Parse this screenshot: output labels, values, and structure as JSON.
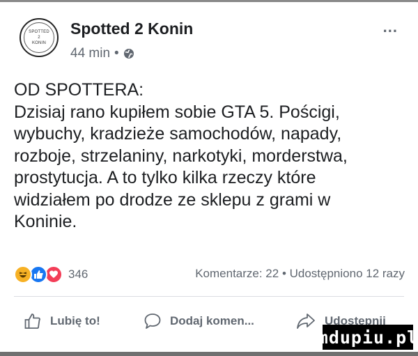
{
  "header": {
    "page_name": "Spotted 2 Konin",
    "time": "44 min",
    "separator": "•",
    "avatar_lines": [
      "SPOTTED",
      "2",
      "KONIN"
    ],
    "more": "..."
  },
  "post": {
    "lines": [
      "OD SPOTTERA:",
      "Dzisiaj rano kupiłem sobie GTA 5. Pościgi,",
      "wybuchy, kradzieże samochodów, napady,",
      "rozboje, strzelaniny, narkotyki, morderstwa,",
      "prostytucja. A to tylko kilka rzeczy które",
      "widziałem po drodze ze sklepu z grami w",
      "Koninie."
    ]
  },
  "reactions": {
    "icons": [
      "haha-reaction-icon",
      "like-reaction-icon",
      "love-reaction-icon"
    ],
    "count": "346",
    "stats": "Komentarze: 22 • Udostępniono 12 razy"
  },
  "actions": {
    "like": "Lubię to!",
    "comment": "Dodaj komen...",
    "share": "Udostępnij"
  },
  "watermark": "mdupiu.pl",
  "colors": {
    "text": "#1c1e21",
    "muted": "#606770",
    "like_blue": "#1877f2",
    "love_red": "#f33e58",
    "haha_yellow": "#f7b125"
  }
}
